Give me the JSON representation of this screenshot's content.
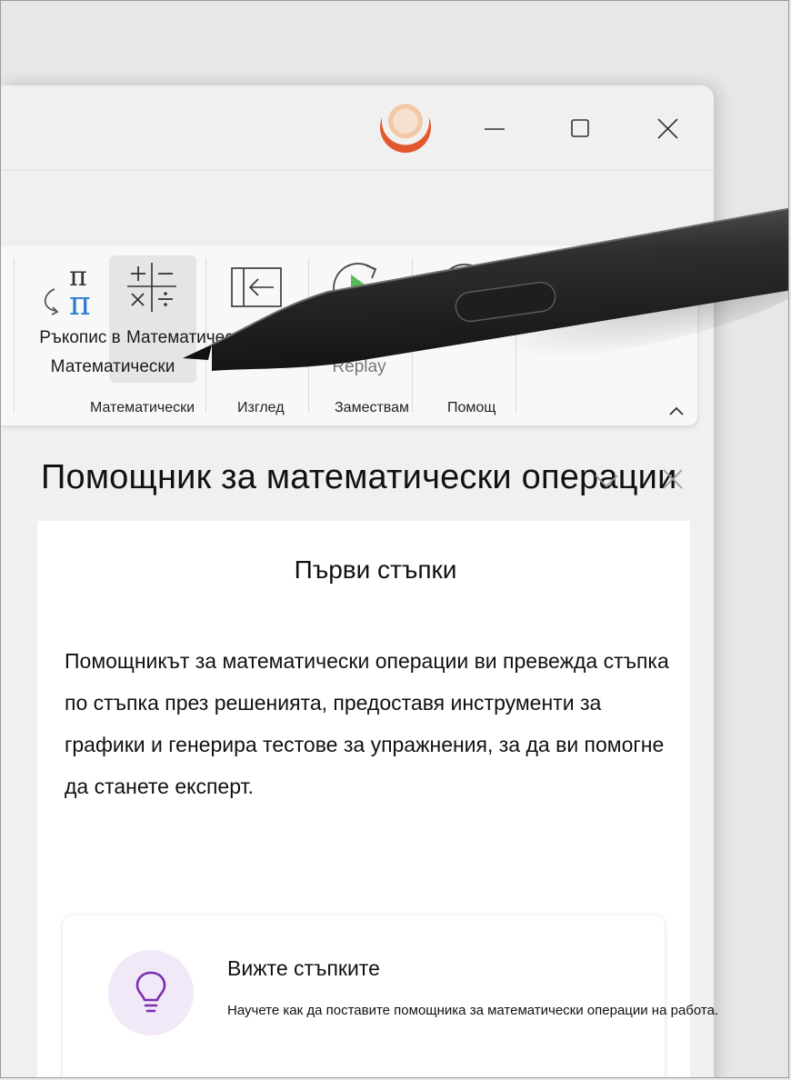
{
  "window": {
    "controls": {
      "minimize_icon": "minimize-icon",
      "maximize_icon": "maximize-icon",
      "close_icon": "close-icon"
    },
    "avatar": "user-avatar"
  },
  "ribbon": {
    "items": [
      {
        "label_line1": "Ръкопис в",
        "label_line2": "Математически",
        "icon": "ink-to-math-icon"
      },
      {
        "label_line1": "Математически",
        "icon": "math-operations-icon"
      },
      {
        "label_line1": "",
        "icon": "view-icon"
      },
      {
        "label_line1": "Replay",
        "icon": "replay-icon"
      },
      {
        "label_line1": "",
        "icon": "help-icon"
      }
    ],
    "groups": [
      "Математически",
      "Изглед",
      "Замествам",
      "Помощ"
    ]
  },
  "pane": {
    "title": "Помощник за математически операции",
    "card_title": "Първи стъпки",
    "body_lines": [
      "Помощникът за математически операции ви превежда стъпка",
      "по стъпка през решенията, предоставя инструменти за",
      "графики и генерира тестове за упражнения, за да ви помогне",
      "да станете експерт."
    ],
    "tip": {
      "title": "Вижте стъпките",
      "desc": "Научете как да поставите помощника за математически операции на работа.",
      "icon": "lightbulb-icon"
    }
  },
  "colors": {
    "accent": "#7a2fb0",
    "tip_bg": "#f1e8f8",
    "replay_green": "#59b95c"
  }
}
